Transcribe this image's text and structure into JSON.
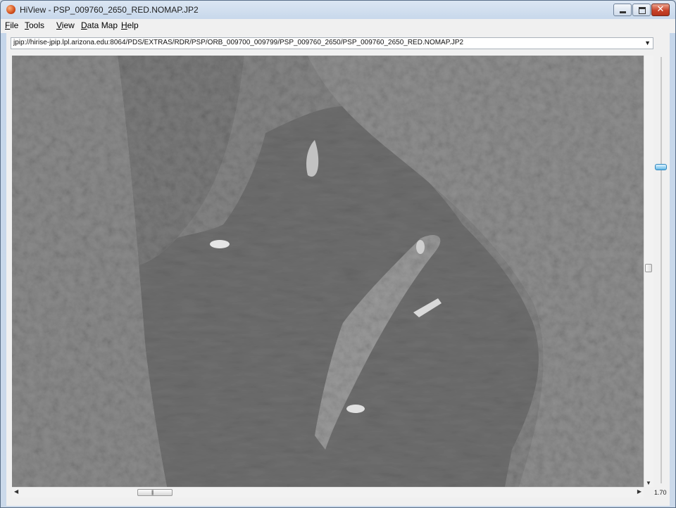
{
  "window": {
    "title": "HiView - PSP_009760_2650_RED.NOMAP.JP2"
  },
  "menu": [
    {
      "id": "file",
      "accel": "F",
      "rest": "ile"
    },
    {
      "id": "tools",
      "accel": "T",
      "rest": "ools"
    },
    {
      "id": "view",
      "accel": "V",
      "rest": "iew"
    },
    {
      "id": "data-map",
      "accel": "D",
      "rest": "ata Map"
    },
    {
      "id": "help",
      "accel": "H",
      "rest": "elp"
    }
  ],
  "source": {
    "url": "jpip://hirise-jpip.lpl.arizona.edu:8064/PDS/EXTRAS/RDR/PSP/ORB_009700_009799/PSP_009760_2650/PSP_009760_2650_RED.NOMAP.JP2"
  },
  "zoom": {
    "label": "1.70"
  },
  "icons": {
    "dropdown": "chevron-down-icon",
    "app": "hiview-app-icon",
    "minimize": "minimize-icon",
    "maximize": "maximize-icon",
    "close": "close-icon"
  },
  "colors": {
    "accent": "#66b9e6",
    "close": "#c8432a"
  }
}
